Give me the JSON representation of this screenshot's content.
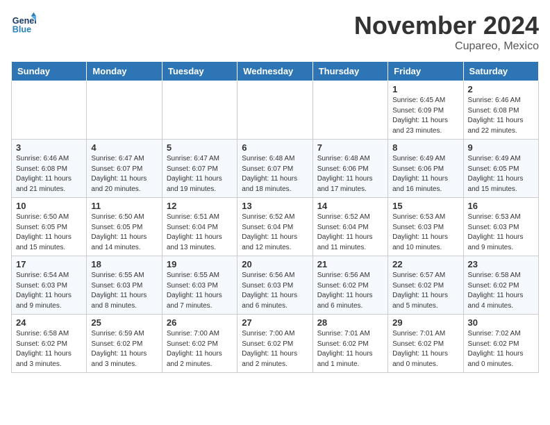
{
  "header": {
    "logo_line1": "General",
    "logo_line2": "Blue",
    "month": "November 2024",
    "location": "Cupareo, Mexico"
  },
  "weekdays": [
    "Sunday",
    "Monday",
    "Tuesday",
    "Wednesday",
    "Thursday",
    "Friday",
    "Saturday"
  ],
  "weeks": [
    [
      {
        "day": "",
        "info": ""
      },
      {
        "day": "",
        "info": ""
      },
      {
        "day": "",
        "info": ""
      },
      {
        "day": "",
        "info": ""
      },
      {
        "day": "",
        "info": ""
      },
      {
        "day": "1",
        "info": "Sunrise: 6:45 AM\nSunset: 6:09 PM\nDaylight: 11 hours\nand 23 minutes."
      },
      {
        "day": "2",
        "info": "Sunrise: 6:46 AM\nSunset: 6:08 PM\nDaylight: 11 hours\nand 22 minutes."
      }
    ],
    [
      {
        "day": "3",
        "info": "Sunrise: 6:46 AM\nSunset: 6:08 PM\nDaylight: 11 hours\nand 21 minutes."
      },
      {
        "day": "4",
        "info": "Sunrise: 6:47 AM\nSunset: 6:07 PM\nDaylight: 11 hours\nand 20 minutes."
      },
      {
        "day": "5",
        "info": "Sunrise: 6:47 AM\nSunset: 6:07 PM\nDaylight: 11 hours\nand 19 minutes."
      },
      {
        "day": "6",
        "info": "Sunrise: 6:48 AM\nSunset: 6:07 PM\nDaylight: 11 hours\nand 18 minutes."
      },
      {
        "day": "7",
        "info": "Sunrise: 6:48 AM\nSunset: 6:06 PM\nDaylight: 11 hours\nand 17 minutes."
      },
      {
        "day": "8",
        "info": "Sunrise: 6:49 AM\nSunset: 6:06 PM\nDaylight: 11 hours\nand 16 minutes."
      },
      {
        "day": "9",
        "info": "Sunrise: 6:49 AM\nSunset: 6:05 PM\nDaylight: 11 hours\nand 15 minutes."
      }
    ],
    [
      {
        "day": "10",
        "info": "Sunrise: 6:50 AM\nSunset: 6:05 PM\nDaylight: 11 hours\nand 15 minutes."
      },
      {
        "day": "11",
        "info": "Sunrise: 6:50 AM\nSunset: 6:05 PM\nDaylight: 11 hours\nand 14 minutes."
      },
      {
        "day": "12",
        "info": "Sunrise: 6:51 AM\nSunset: 6:04 PM\nDaylight: 11 hours\nand 13 minutes."
      },
      {
        "day": "13",
        "info": "Sunrise: 6:52 AM\nSunset: 6:04 PM\nDaylight: 11 hours\nand 12 minutes."
      },
      {
        "day": "14",
        "info": "Sunrise: 6:52 AM\nSunset: 6:04 PM\nDaylight: 11 hours\nand 11 minutes."
      },
      {
        "day": "15",
        "info": "Sunrise: 6:53 AM\nSunset: 6:03 PM\nDaylight: 11 hours\nand 10 minutes."
      },
      {
        "day": "16",
        "info": "Sunrise: 6:53 AM\nSunset: 6:03 PM\nDaylight: 11 hours\nand 9 minutes."
      }
    ],
    [
      {
        "day": "17",
        "info": "Sunrise: 6:54 AM\nSunset: 6:03 PM\nDaylight: 11 hours\nand 9 minutes."
      },
      {
        "day": "18",
        "info": "Sunrise: 6:55 AM\nSunset: 6:03 PM\nDaylight: 11 hours\nand 8 minutes."
      },
      {
        "day": "19",
        "info": "Sunrise: 6:55 AM\nSunset: 6:03 PM\nDaylight: 11 hours\nand 7 minutes."
      },
      {
        "day": "20",
        "info": "Sunrise: 6:56 AM\nSunset: 6:03 PM\nDaylight: 11 hours\nand 6 minutes."
      },
      {
        "day": "21",
        "info": "Sunrise: 6:56 AM\nSunset: 6:02 PM\nDaylight: 11 hours\nand 6 minutes."
      },
      {
        "day": "22",
        "info": "Sunrise: 6:57 AM\nSunset: 6:02 PM\nDaylight: 11 hours\nand 5 minutes."
      },
      {
        "day": "23",
        "info": "Sunrise: 6:58 AM\nSunset: 6:02 PM\nDaylight: 11 hours\nand 4 minutes."
      }
    ],
    [
      {
        "day": "24",
        "info": "Sunrise: 6:58 AM\nSunset: 6:02 PM\nDaylight: 11 hours\nand 3 minutes."
      },
      {
        "day": "25",
        "info": "Sunrise: 6:59 AM\nSunset: 6:02 PM\nDaylight: 11 hours\nand 3 minutes."
      },
      {
        "day": "26",
        "info": "Sunrise: 7:00 AM\nSunset: 6:02 PM\nDaylight: 11 hours\nand 2 minutes."
      },
      {
        "day": "27",
        "info": "Sunrise: 7:00 AM\nSunset: 6:02 PM\nDaylight: 11 hours\nand 2 minutes."
      },
      {
        "day": "28",
        "info": "Sunrise: 7:01 AM\nSunset: 6:02 PM\nDaylight: 11 hours\nand 1 minute."
      },
      {
        "day": "29",
        "info": "Sunrise: 7:01 AM\nSunset: 6:02 PM\nDaylight: 11 hours\nand 0 minutes."
      },
      {
        "day": "30",
        "info": "Sunrise: 7:02 AM\nSunset: 6:02 PM\nDaylight: 11 hours\nand 0 minutes."
      }
    ]
  ]
}
